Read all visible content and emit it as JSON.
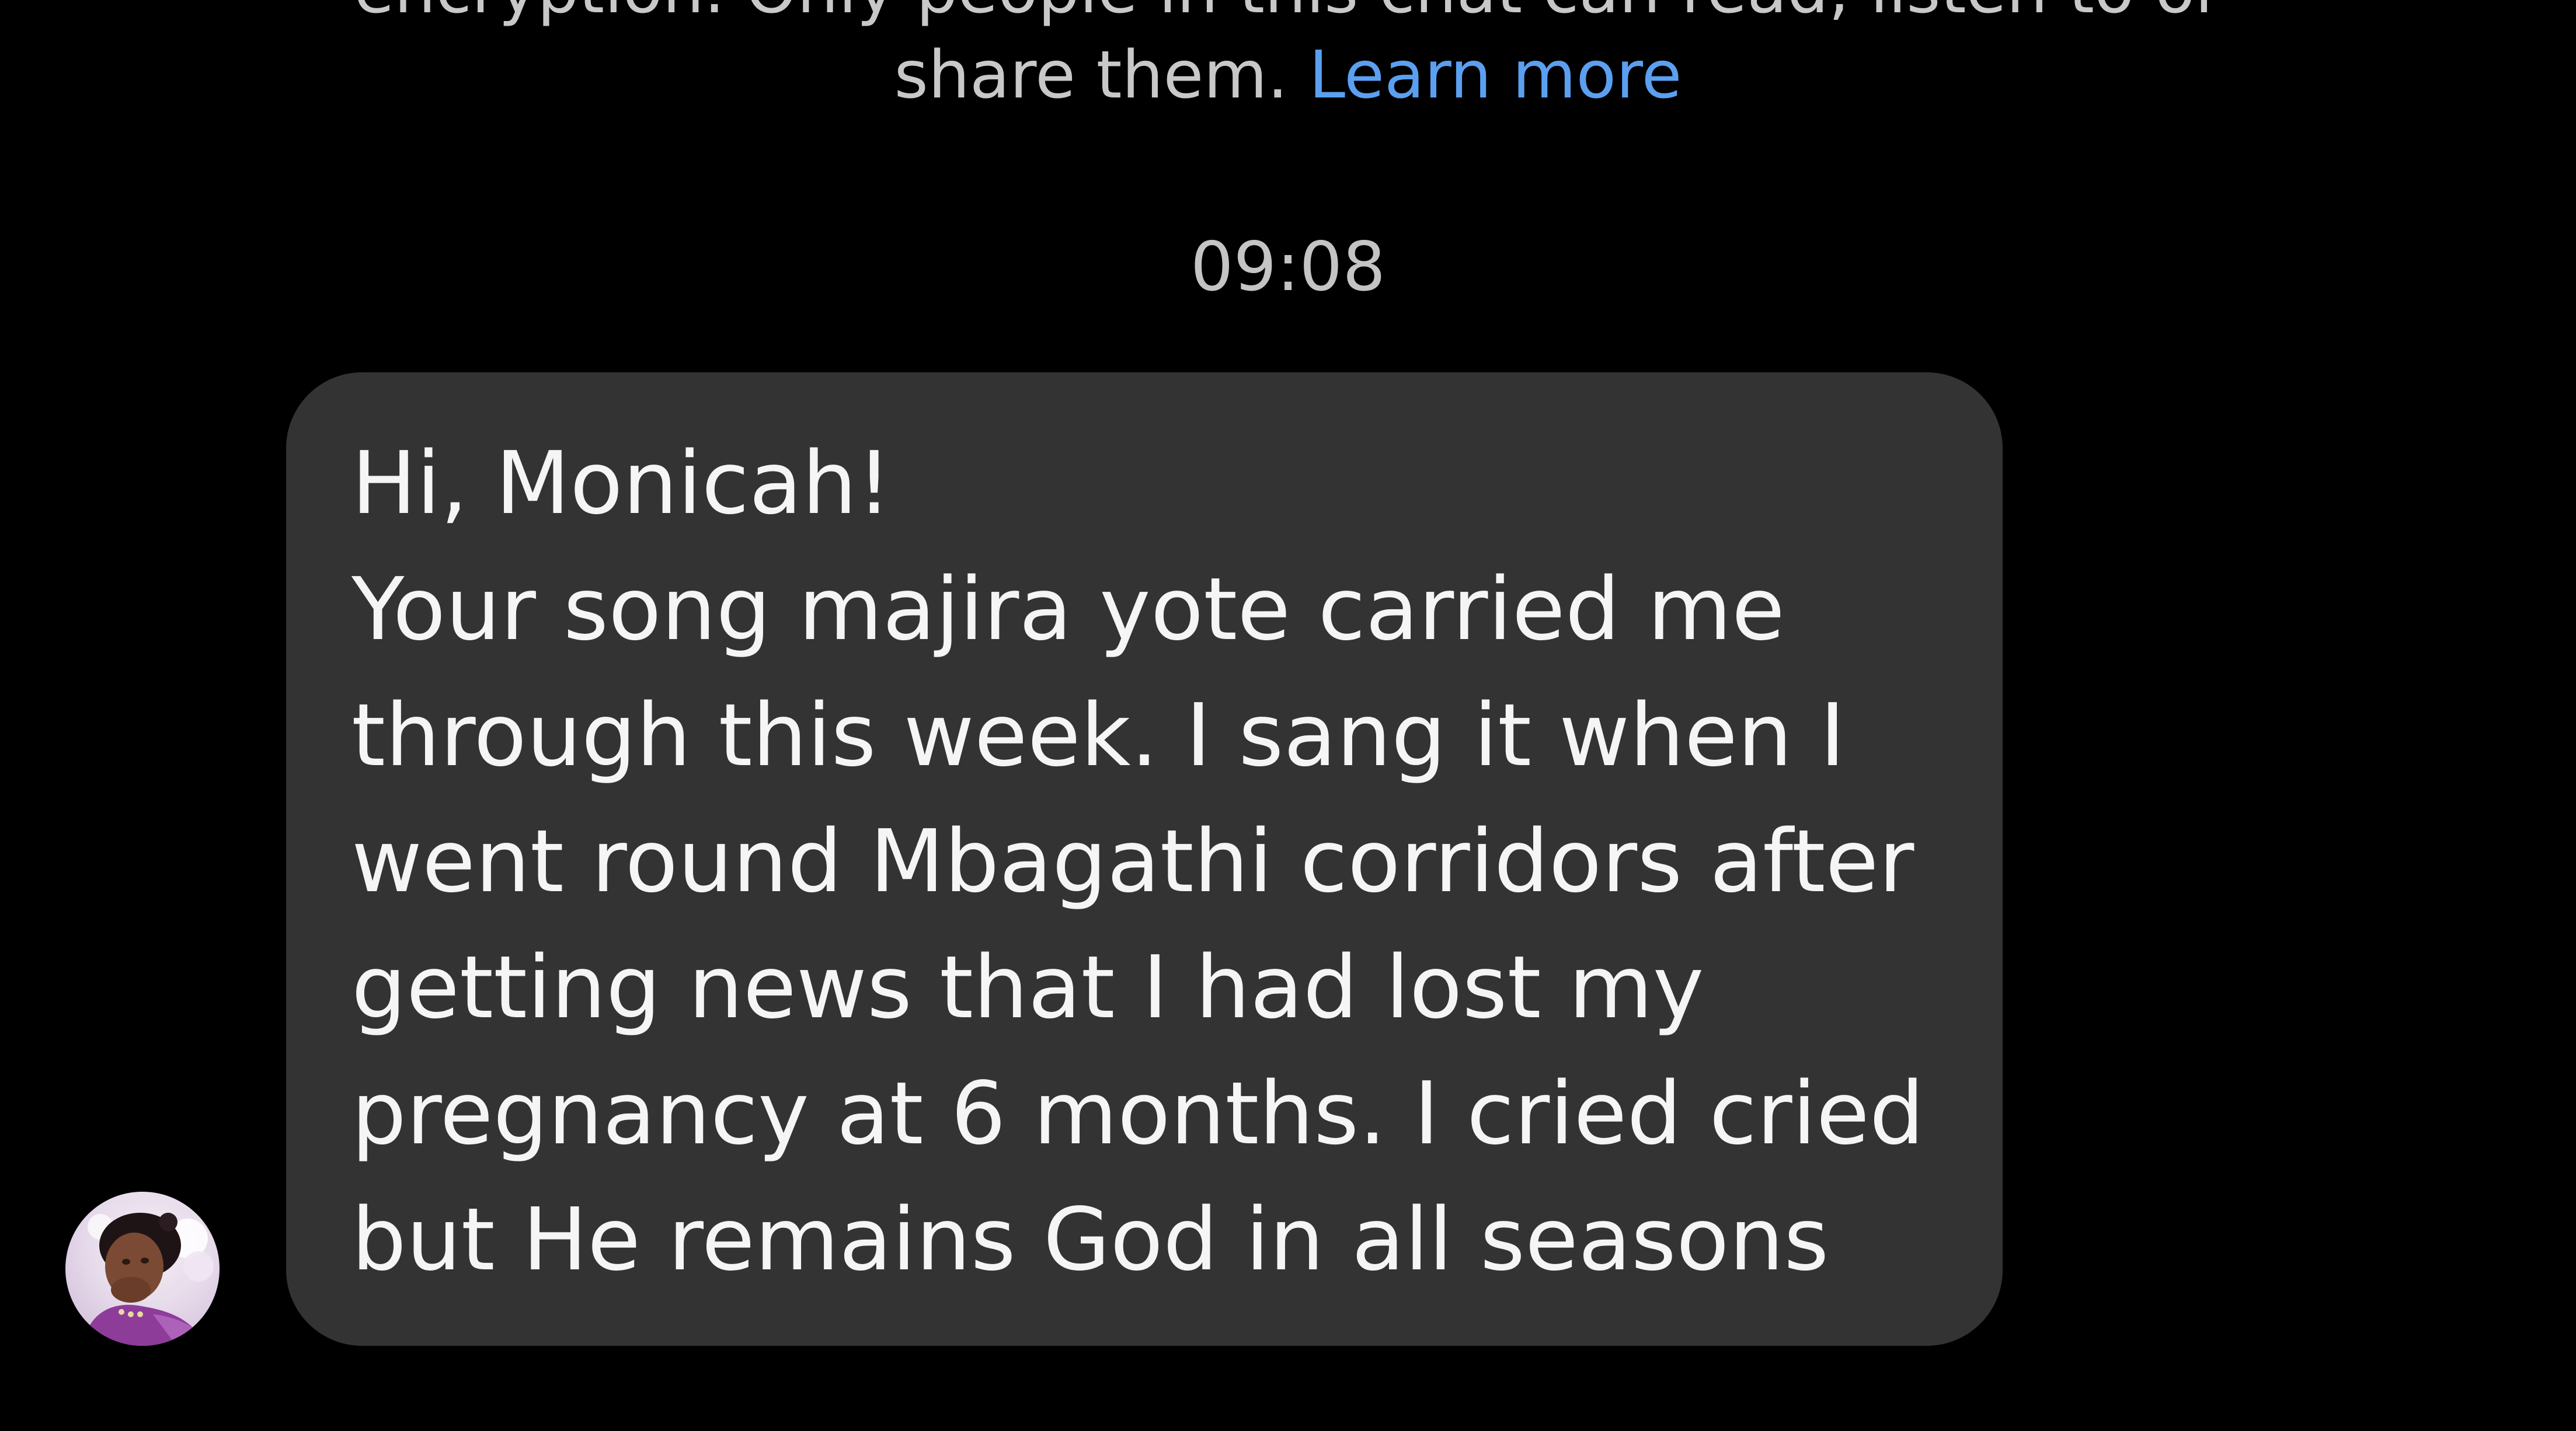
{
  "chat": {
    "encryption_notice": {
      "line1": "encryption. Only people in this chat can read, listen to or",
      "line2_text": "share them.",
      "learn_more": "Learn more"
    },
    "timestamp": "09:08",
    "message": {
      "lines": [
        "Hi, Monicah!",
        "Your song majira yote carried me",
        "through this week. I sang it when I",
        "went round Mbagathi corridors after",
        "getting news that I had lost my",
        "pregnancy at 6 months. I cried cried",
        "but He remains God in all seasons"
      ]
    },
    "sender": {
      "avatar_icon": "profile-photo"
    }
  },
  "colors": {
    "background": "#000000",
    "bubble": "#333333",
    "link": "#5b9ff0",
    "notice_text": "#c8c8c8",
    "message_text": "#f5f5f5"
  }
}
